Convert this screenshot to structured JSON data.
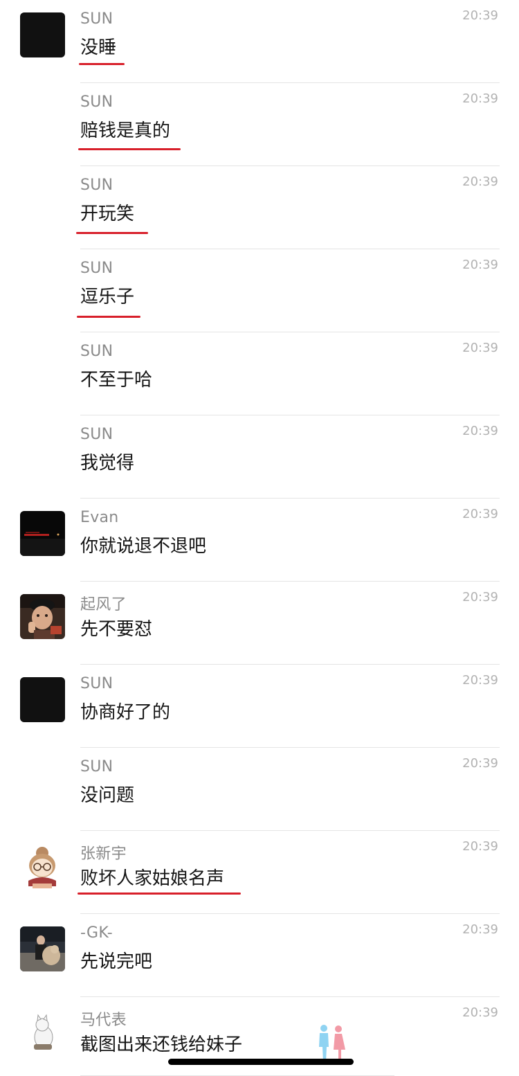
{
  "messages": [
    {
      "sender": "SUN",
      "text": "没睡",
      "time": "20:39",
      "avatar": "black-square"
    },
    {
      "sender": "SUN",
      "text": "赔钱是真的",
      "time": "20:39",
      "avatar": ""
    },
    {
      "sender": "SUN",
      "text": "开玩笑",
      "time": "20:39",
      "avatar": ""
    },
    {
      "sender": "SUN",
      "text": "逗乐子",
      "time": "20:39",
      "avatar": ""
    },
    {
      "sender": "SUN",
      "text": "不至于哈",
      "time": "20:39",
      "avatar": ""
    },
    {
      "sender": "SUN",
      "text": "我觉得",
      "time": "20:39",
      "avatar": ""
    },
    {
      "sender": "Evan",
      "text": "你就说退不退吧",
      "time": "20:39",
      "avatar": "night-road"
    },
    {
      "sender": "起风了",
      "text": "先不要怼",
      "time": "20:39",
      "avatar": "child-photo"
    },
    {
      "sender": "SUN",
      "text": "协商好了的",
      "time": "20:39",
      "avatar": "black-square"
    },
    {
      "sender": "SUN",
      "text": "没问题",
      "time": "20:39",
      "avatar": ""
    },
    {
      "sender": "张新宇",
      "text": "败坏人家姑娘名声",
      "time": "20:39",
      "avatar": "cartoon-girl"
    },
    {
      "sender": "-GK-",
      "text": "先说完吧",
      "time": "20:39",
      "avatar": "street-photo"
    },
    {
      "sender": "马代表",
      "text": "截图出来还钱给妹子",
      "time": "20:39",
      "avatar": "cat-illustration"
    }
  ],
  "colors": {
    "underline": "#d81f2a",
    "name": "#8a8a8a",
    "message": "#141414",
    "time": "#b2b2b2"
  }
}
